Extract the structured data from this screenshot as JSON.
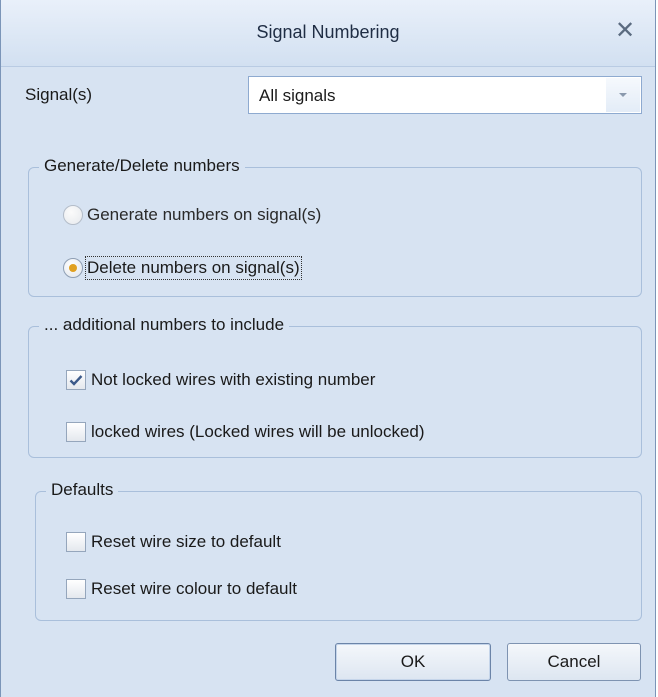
{
  "dialog": {
    "title": "Signal Numbering",
    "close_icon": "close-icon"
  },
  "signals": {
    "label": "Signal(s)",
    "value": "All signals",
    "dropdown_icon": "chevron-down-icon"
  },
  "generate_group": {
    "legend": "Generate/Delete numbers",
    "options": [
      {
        "label": "Generate numbers on signal(s)",
        "checked": false,
        "enabled": false
      },
      {
        "label": "Delete numbers on signal(s)",
        "checked": true,
        "enabled": true
      }
    ]
  },
  "additional_group": {
    "legend": "... additional numbers to include",
    "options": [
      {
        "label": "Not locked wires with existing number",
        "checked": true
      },
      {
        "label": "locked wires (Locked wires will be unlocked)",
        "checked": false
      }
    ]
  },
  "defaults_group": {
    "legend": "Defaults",
    "options": [
      {
        "label": "Reset wire size to default",
        "checked": false
      },
      {
        "label": "Reset wire colour to default",
        "checked": false
      }
    ]
  },
  "buttons": {
    "ok": "OK",
    "cancel": "Cancel"
  },
  "colors": {
    "dialog_bg": "#d7e3f2",
    "radio_selected": "#e0a020"
  }
}
